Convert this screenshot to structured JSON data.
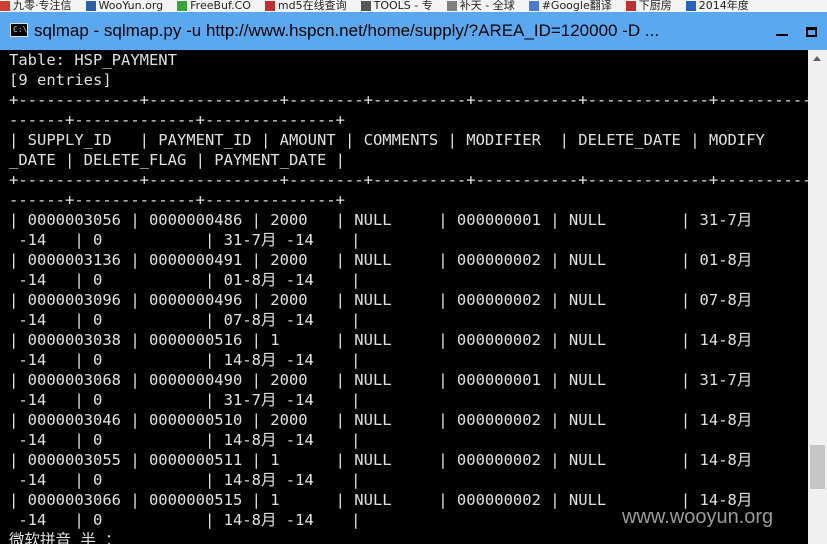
{
  "bookmarks": [
    {
      "label": "九零·专注信",
      "icon": "site-icon",
      "color": "#d04030"
    },
    {
      "label": "WooYun.org",
      "icon": "wooyun-icon",
      "color": "#2d5da8"
    },
    {
      "label": "FreeBuf.CO",
      "icon": "freebuf-icon",
      "color": "#3aa53a"
    },
    {
      "label": "md5在线查询",
      "icon": "grid-icon",
      "color": "#c03030"
    },
    {
      "label": "TOOLS - 专",
      "icon": "tools-icon",
      "color": "#555555"
    },
    {
      "label": "补天 - 全球",
      "icon": "star-icon",
      "color": "#808080"
    },
    {
      "label": "#Google翻译",
      "icon": "translate-icon",
      "color": "#4a7bd0"
    },
    {
      "label": "下厨房",
      "icon": "kitchen-icon",
      "color": "#c03030"
    },
    {
      "label": "2014年度",
      "icon": "circle-icon",
      "color": "#2a60c0"
    }
  ],
  "window": {
    "title": "sqlmap - sqlmap.py  -u http://www.hspcn.net/home/supply/?AREA_ID=120000 -D ...",
    "icon": "cmd-icon",
    "icon_text": "C:\\"
  },
  "console_lines": [
    "Table: HSP_PAYMENT",
    "[9 entries]",
    "+-------------+--------------+--------+----------+-----------+-------------+-----------",
    "------+-------------+--------------+",
    "| SUPPLY_ID   | PAYMENT_ID | AMOUNT | COMMENTS | MODIFIER  | DELETE_DATE | MODIFY",
    "_DATE | DELETE_FLAG | PAYMENT_DATE |",
    "+-------------+--------------+--------+----------+-----------+-------------+-----------",
    "------+-------------+--------------+",
    "| 0000003056 | 0000000486 | 2000   | NULL     | 000000001 | NULL        | 31-7月",
    " -14   | 0           | 31-7月 -14    |",
    "| 0000003136 | 0000000491 | 2000   | NULL     | 000000002 | NULL        | 01-8月",
    " -14   | 0           | 01-8月 -14    |",
    "| 0000003096 | 0000000496 | 2000   | NULL     | 000000002 | NULL        | 07-8月",
    " -14   | 0           | 07-8月 -14    |",
    "| 0000003038 | 0000000516 | 1      | NULL     | 000000002 | NULL        | 14-8月",
    " -14   | 0           | 14-8月 -14    |",
    "| 0000003068 | 0000000490 | 2000   | NULL     | 000000001 | NULL        | 31-7月",
    " -14   | 0           | 31-7月 -14    |",
    "| 0000003046 | 0000000510 | 2000   | NULL     | 000000002 | NULL        | 14-8月",
    " -14   | 0           | 14-8月 -14    |",
    "| 0000003055 | 0000000511 | 1      | NULL     | 000000002 | NULL        | 14-8月",
    " -14   | 0           | 14-8月 -14    |",
    "| 0000003066 | 0000000515 | 1      | NULL     | 000000002 | NULL        | 14-8月",
    " -14   | 0           | 14-8月 -14    |",
    "微软拼音 半 ："
  ],
  "watermark": "www.wooyun.org",
  "colors": {
    "titlebar": "#5aa9f0",
    "console_bg": "#000000",
    "console_text": "#e0e0e0",
    "scrollbar": "#f0f0f0"
  }
}
